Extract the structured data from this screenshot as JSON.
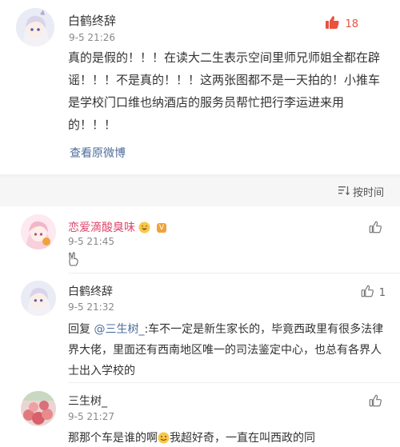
{
  "post": {
    "author": "白鹤终辞",
    "time": "9-5 21:26",
    "likes": "18",
    "body": "真的是假的！！！在读大二生表示空间里师兄师姐全都在辟谣！！！不是真的！！！这两张图都不是一天拍的！小推车是学校门口维也纳酒店的服务员帮忙把行李运进来用的！！！",
    "view_original": "查看原微博"
  },
  "sort": {
    "label": "按时间"
  },
  "comments": [
    {
      "author": "恋爱滴酸臭味",
      "badge": "V",
      "time": "9-5 21:45",
      "likes": "",
      "body": ""
    },
    {
      "author": "白鹤终辞",
      "time": "9-5 21:32",
      "likes": "1",
      "reply_prefix": "回复 ",
      "reply_to": "@三生树_",
      "body": ":车不一定是新生家长的，毕竟西政里有很多法律界大佬，里面还有西南地区唯一的司法鉴定中心，也总有各界人士出入学校的"
    },
    {
      "author": "三生树_",
      "time": "9-5 21:27",
      "likes": "",
      "body_part1": "那那个车是谁的啊",
      "body_part2": "我超好奇，一直在叫西政的同"
    }
  ],
  "colors": {
    "like_active": "#e8523f",
    "link": "#4d6e9a",
    "name_pink": "#e0456b"
  }
}
